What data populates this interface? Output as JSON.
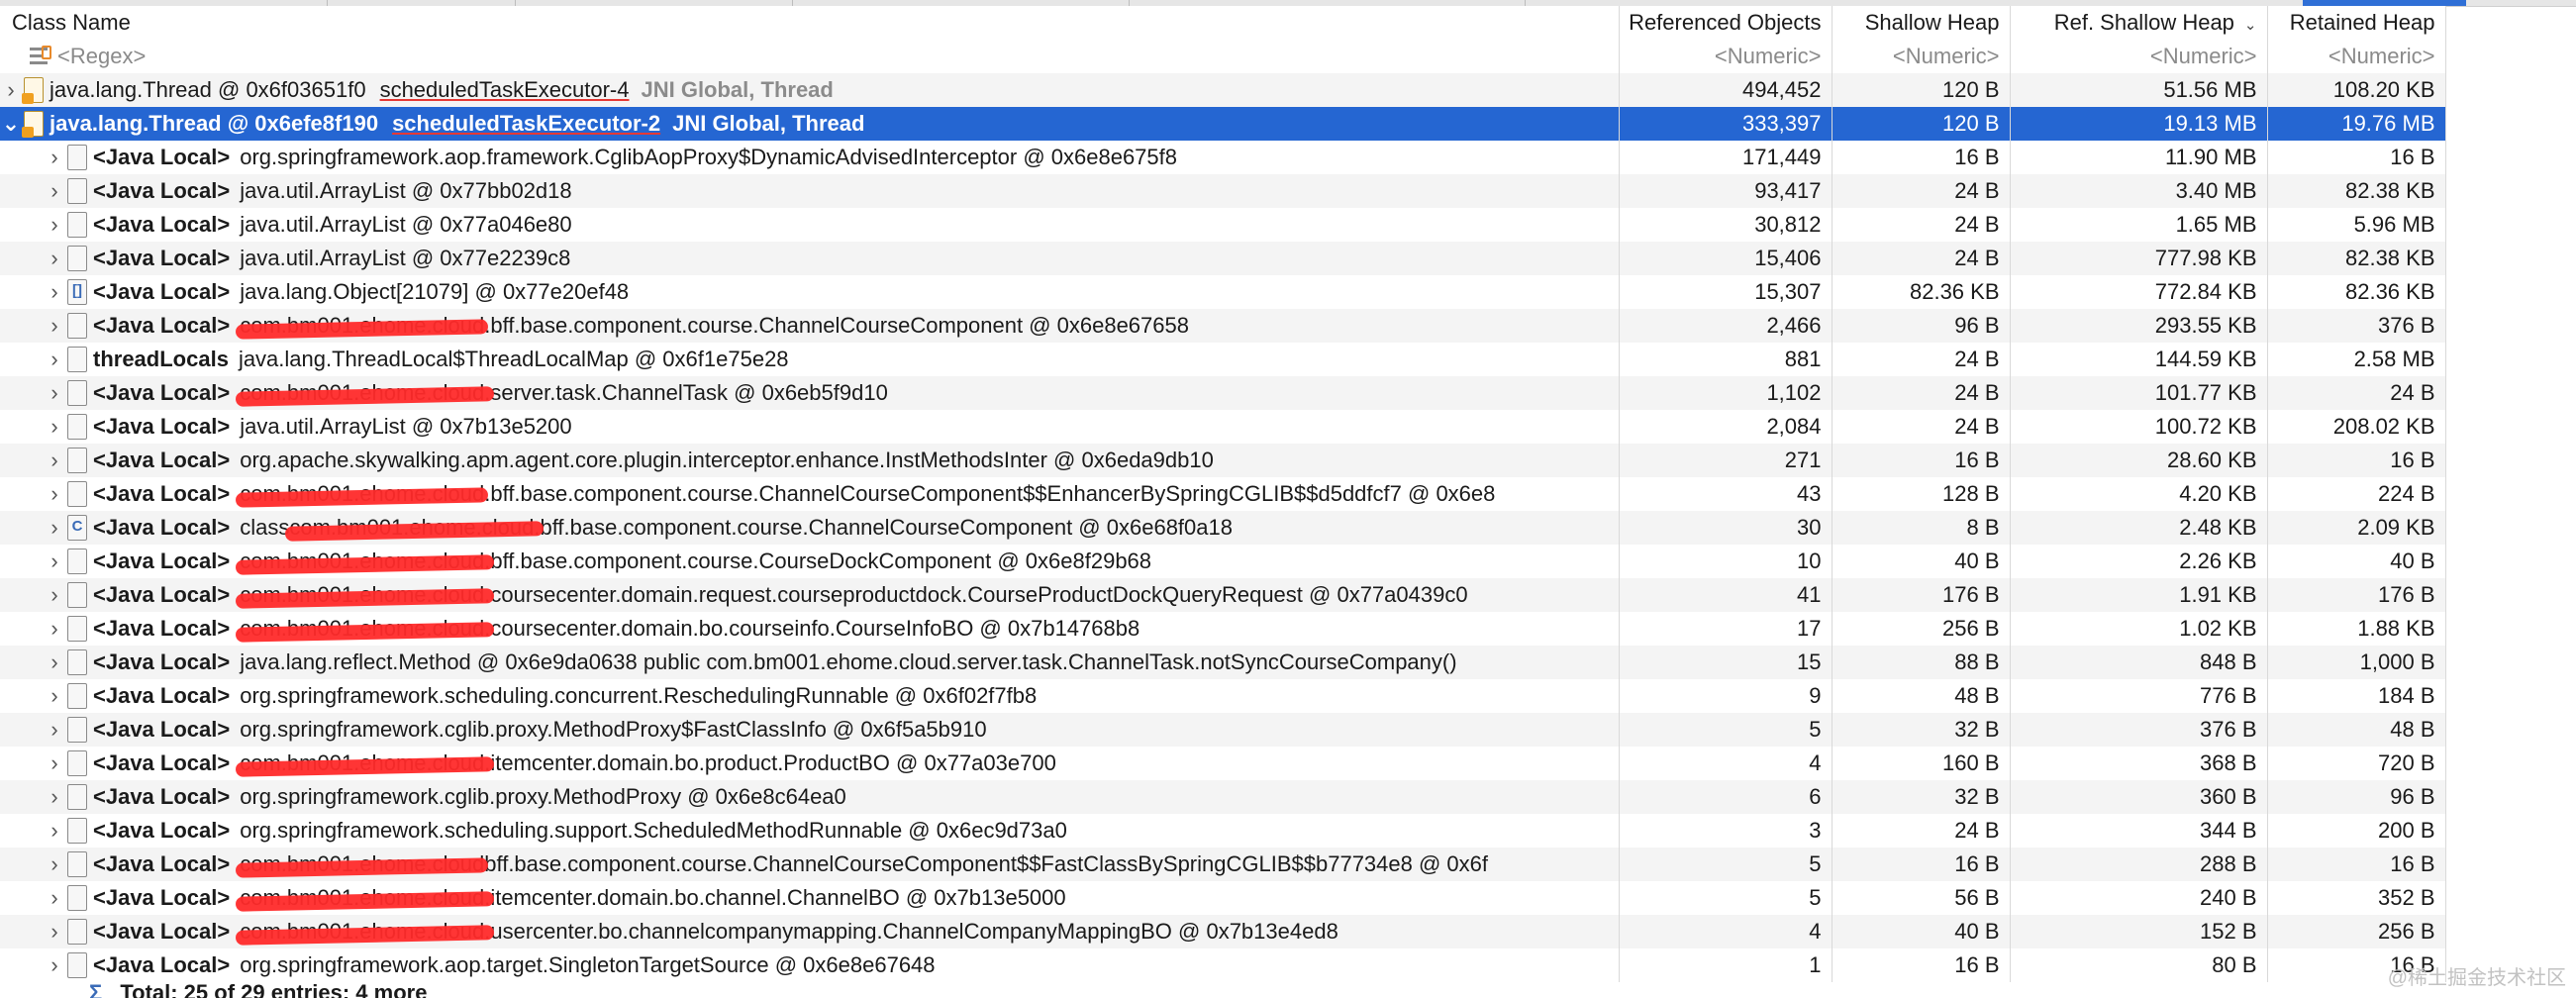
{
  "columns": {
    "class_name": "Class Name",
    "referenced_objects": "Referenced Objects",
    "shallow_heap": "Shallow Heap",
    "ref_shallow_heap": "Ref. Shallow Heap",
    "retained_heap": "Retained Heap",
    "sort_indicator": "chevron-down-icon"
  },
  "filter": {
    "class_name": "<Regex>",
    "referenced_objects": "<Numeric>",
    "shallow_heap": "<Numeric>",
    "ref_shallow_heap": "<Numeric>",
    "retained_heap": "<Numeric>"
  },
  "threads": [
    {
      "name": "java.lang.Thread @ 0x6f03651f0",
      "thread_label": "scheduledTaskExecutor-4",
      "tags": "JNI Global, Thread",
      "referenced_objects": "494,452",
      "shallow_heap": "120 B",
      "ref_shallow_heap": "51.56 MB",
      "retained_heap": "108.20 KB"
    },
    {
      "name": "java.lang.Thread @ 0x6efe8f190",
      "thread_label": "scheduledTaskExecutor-2",
      "tags": "JNI Global, Thread",
      "referenced_objects": "333,397",
      "shallow_heap": "120 B",
      "ref_shallow_heap": "19.13 MB",
      "retained_heap": "19.76 MB"
    }
  ],
  "rows": [
    {
      "label": "<Java Local>",
      "prefix": "",
      "redacted": "",
      "text": "org.springframework.aop.framework.CglibAopProxy$DynamicAdvisedInterceptor @ 0x6e8e675f8",
      "icon": "file-icon",
      "referenced_objects": "171,449",
      "shallow_heap": "16 B",
      "ref_shallow_heap": "11.90 MB",
      "retained_heap": "16 B"
    },
    {
      "label": "<Java Local>",
      "prefix": "",
      "redacted": "",
      "text": "java.util.ArrayList @ 0x77bb02d18",
      "icon": "file-icon",
      "referenced_objects": "93,417",
      "shallow_heap": "24 B",
      "ref_shallow_heap": "3.40 MB",
      "retained_heap": "82.38 KB"
    },
    {
      "label": "<Java Local>",
      "prefix": "",
      "redacted": "",
      "text": "java.util.ArrayList @ 0x77a046e80",
      "icon": "file-icon",
      "referenced_objects": "30,812",
      "shallow_heap": "24 B",
      "ref_shallow_heap": "1.65 MB",
      "retained_heap": "5.96 MB"
    },
    {
      "label": "<Java Local>",
      "prefix": "",
      "redacted": "",
      "text": "java.util.ArrayList @ 0x77e2239c8",
      "icon": "file-icon",
      "referenced_objects": "15,406",
      "shallow_heap": "24 B",
      "ref_shallow_heap": "777.98 KB",
      "retained_heap": "82.38 KB"
    },
    {
      "label": "<Java Local>",
      "prefix": "",
      "redacted": "",
      "text": "java.lang.Object[21079] @ 0x77e20ef48",
      "icon": "array-icon",
      "referenced_objects": "15,307",
      "shallow_heap": "82.36 KB",
      "ref_shallow_heap": "772.84 KB",
      "retained_heap": "82.36 KB"
    },
    {
      "label": "<Java Local>",
      "prefix": "",
      "redacted": "com.bm001.ehome.cloud",
      "text": ".bff.base.component.course.ChannelCourseComponent @ 0x6e8e67658",
      "icon": "file-icon",
      "referenced_objects": "2,466",
      "shallow_heap": "96 B",
      "ref_shallow_heap": "293.55 KB",
      "retained_heap": "376 B"
    },
    {
      "label": "threadLocals",
      "prefix": "",
      "redacted": "",
      "text": "java.lang.ThreadLocal$ThreadLocalMap @ 0x6f1e75e28",
      "icon": "file-icon",
      "referenced_objects": "881",
      "shallow_heap": "24 B",
      "ref_shallow_heap": "144.59 KB",
      "retained_heap": "2.58 MB"
    },
    {
      "label": "<Java Local>",
      "prefix": "",
      "redacted": "com.bm001.ehome.cloud.",
      "text": "server.task.ChannelTask @ 0x6eb5f9d10",
      "icon": "file-icon",
      "referenced_objects": "1,102",
      "shallow_heap": "24 B",
      "ref_shallow_heap": "101.77 KB",
      "retained_heap": "24 B"
    },
    {
      "label": "<Java Local>",
      "prefix": "",
      "redacted": "",
      "text": "java.util.ArrayList @ 0x7b13e5200",
      "icon": "file-icon",
      "referenced_objects": "2,084",
      "shallow_heap": "24 B",
      "ref_shallow_heap": "100.72 KB",
      "retained_heap": "208.02 KB"
    },
    {
      "label": "<Java Local>",
      "prefix": "",
      "redacted": "",
      "text": "org.apache.skywalking.apm.agent.core.plugin.interceptor.enhance.InstMethodsInter @ 0x6eda9db10",
      "icon": "file-icon",
      "referenced_objects": "271",
      "shallow_heap": "16 B",
      "ref_shallow_heap": "28.60 KB",
      "retained_heap": "16 B"
    },
    {
      "label": "<Java Local>",
      "prefix": "",
      "redacted": "com.bm001.ehome.cloud",
      "text": ".bff.base.component.course.ChannelCourseComponent$$EnhancerBySpringCGLIB$$d5ddfcf7 @ 0x6e8",
      "icon": "file-icon",
      "referenced_objects": "43",
      "shallow_heap": "128 B",
      "ref_shallow_heap": "4.20 KB",
      "retained_heap": "224 B"
    },
    {
      "label": "<Java Local>",
      "prefix": "class ",
      "redacted": "com.bm001.ehome.cloud.",
      "text": "bff.base.component.course.ChannelCourseComponent @ 0x6e68f0a18",
      "icon": "class-icon",
      "referenced_objects": "30",
      "shallow_heap": "8 B",
      "ref_shallow_heap": "2.48 KB",
      "retained_heap": "2.09 KB"
    },
    {
      "label": "<Java Local>",
      "prefix": "",
      "redacted": "com.bm001.ehome.cloud.",
      "text": "bff.base.component.course.CourseDockComponent @ 0x6e8f29b68",
      "icon": "file-icon",
      "referenced_objects": "10",
      "shallow_heap": "40 B",
      "ref_shallow_heap": "2.26 KB",
      "retained_heap": "40 B"
    },
    {
      "label": "<Java Local>",
      "prefix": "",
      "redacted": "com.bm001.ehome.cloud.",
      "text": "coursecenter.domain.request.courseproductdock.CourseProductDockQueryRequest @ 0x77a0439c0",
      "icon": "file-icon",
      "referenced_objects": "41",
      "shallow_heap": "176 B",
      "ref_shallow_heap": "1.91 KB",
      "retained_heap": "176 B"
    },
    {
      "label": "<Java Local>",
      "prefix": "",
      "redacted": "com.bm001.ehome.cloud.",
      "text": "coursecenter.domain.bo.courseinfo.CourseInfoBO @ 0x7b14768b8",
      "icon": "file-icon",
      "referenced_objects": "17",
      "shallow_heap": "256 B",
      "ref_shallow_heap": "1.02 KB",
      "retained_heap": "1.88 KB"
    },
    {
      "label": "<Java Local>",
      "prefix": "",
      "redacted": "",
      "text": "java.lang.reflect.Method @ 0x6e9da0638  public  com.bm001.ehome.cloud.server.task.ChannelTask.notSyncCourseCompany()",
      "icon": "file-icon",
      "referenced_objects": "15",
      "shallow_heap": "88 B",
      "ref_shallow_heap": "848 B",
      "retained_heap": "1,000 B"
    },
    {
      "label": "<Java Local>",
      "prefix": "",
      "redacted": "",
      "text": "org.springframework.scheduling.concurrent.ReschedulingRunnable @ 0x6f02f7fb8",
      "icon": "file-icon",
      "referenced_objects": "9",
      "shallow_heap": "48 B",
      "ref_shallow_heap": "776 B",
      "retained_heap": "184 B"
    },
    {
      "label": "<Java Local>",
      "prefix": "",
      "redacted": "",
      "text": "org.springframework.cglib.proxy.MethodProxy$FastClassInfo @ 0x6f5a5b910",
      "icon": "file-icon",
      "referenced_objects": "5",
      "shallow_heap": "32 B",
      "ref_shallow_heap": "376 B",
      "retained_heap": "48 B"
    },
    {
      "label": "<Java Local>",
      "prefix": "",
      "redacted": "com.bm001.ehome.cloud.",
      "text": "itemcenter.domain.bo.product.ProductBO @ 0x77a03e700",
      "icon": "file-icon",
      "referenced_objects": "4",
      "shallow_heap": "160 B",
      "ref_shallow_heap": "368 B",
      "retained_heap": "720 B"
    },
    {
      "label": "<Java Local>",
      "prefix": "",
      "redacted": "",
      "text": "org.springframework.cglib.proxy.MethodProxy @ 0x6e8c64ea0",
      "icon": "file-icon",
      "referenced_objects": "6",
      "shallow_heap": "32 B",
      "ref_shallow_heap": "360 B",
      "retained_heap": "96 B"
    },
    {
      "label": "<Java Local>",
      "prefix": "",
      "redacted": "",
      "text": "org.springframework.scheduling.support.ScheduledMethodRunnable @ 0x6ec9d73a0",
      "icon": "file-icon",
      "referenced_objects": "3",
      "shallow_heap": "24 B",
      "ref_shallow_heap": "344 B",
      "retained_heap": "200 B"
    },
    {
      "label": "<Java Local>",
      "prefix": "",
      "redacted": "com.bm001.ehome.cloud",
      "text": "bff.base.component.course.ChannelCourseComponent$$FastClassBySpringCGLIB$$b77734e8 @ 0x6f",
      "icon": "file-icon",
      "referenced_objects": "5",
      "shallow_heap": "16 B",
      "ref_shallow_heap": "288 B",
      "retained_heap": "16 B"
    },
    {
      "label": "<Java Local>",
      "prefix": "",
      "redacted": "com.bm001.ehome.cloud.",
      "text": "itemcenter.domain.bo.channel.ChannelBO @ 0x7b13e5000",
      "icon": "file-icon",
      "referenced_objects": "5",
      "shallow_heap": "56 B",
      "ref_shallow_heap": "240 B",
      "retained_heap": "352 B"
    },
    {
      "label": "<Java Local>",
      "prefix": "",
      "redacted": "com.bm001.ehome.cloud.",
      "text": "usercenter.bo.channelcompanymapping.ChannelCompanyMappingBO @ 0x7b13e4ed8",
      "icon": "file-icon",
      "referenced_objects": "4",
      "shallow_heap": "40 B",
      "ref_shallow_heap": "152 B",
      "retained_heap": "256 B"
    },
    {
      "label": "<Java Local>",
      "prefix": "",
      "redacted": "",
      "text": "org.springframework.aop.target.SingletonTargetSource @ 0x6e8e67648",
      "icon": "file-icon",
      "referenced_objects": "1",
      "shallow_heap": "16 B",
      "ref_shallow_heap": "80 B",
      "retained_heap": "16 B"
    }
  ],
  "footer": {
    "text": "Total: 25 of 29 entries; 4 more"
  },
  "watermark": "@稀土掘金技术社区",
  "colors": {
    "selection": "#2566d2",
    "alt_row": "#f4f4f4",
    "redaction": "#ff2a2a"
  }
}
